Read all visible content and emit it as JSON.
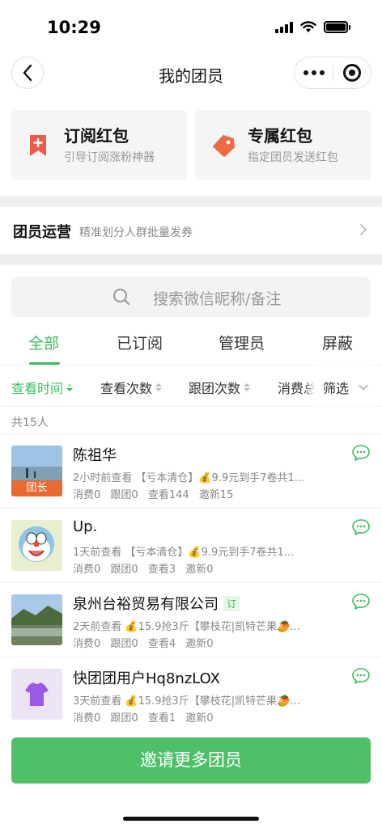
{
  "status": {
    "time": "10:29"
  },
  "nav": {
    "title": "我的团员"
  },
  "cards": [
    {
      "title": "订阅红包",
      "subtitle": "引导订阅涨粉神器",
      "icon": "bookmark-plus-icon",
      "color": "#ee5a47"
    },
    {
      "title": "专属红包",
      "subtitle": "指定团员发送红包",
      "icon": "tag-icon",
      "color": "#ee6a45"
    }
  ],
  "ops": {
    "title": "团员运营",
    "subtitle": "精准划分人群批量发券"
  },
  "search": {
    "placeholder": "搜索微信昵称/备注"
  },
  "tabs": [
    {
      "label": "全部",
      "active": true
    },
    {
      "label": "已订阅"
    },
    {
      "label": "管理员"
    },
    {
      "label": "屏蔽"
    }
  ],
  "sort": [
    {
      "label": "查看时间",
      "active": true
    },
    {
      "label": "查看次数"
    },
    {
      "label": "跟团次数"
    },
    {
      "label": "消费总"
    }
  ],
  "filter": {
    "label": "筛选"
  },
  "count": "共15人",
  "members": [
    {
      "name": "陈祖华",
      "tag": "团长",
      "line1": "2小时前查看 【亏本清仓】💰9.9元到手7卷共1...",
      "consume": "消费0",
      "join": "跟团0",
      "view": "查看144",
      "invite": "邀新15"
    },
    {
      "name": "Up.",
      "line1": "1天前查看 【亏本清仓】💰9.9元到手7卷共1...",
      "consume": "消费0",
      "join": "跟团0",
      "view": "查看3",
      "invite": "邀新0"
    },
    {
      "name": "泉州台裕贸易有限公司",
      "badge": "订",
      "line1": "2天前查看 💰15.9抢3斤【攀枝花|凯特芒果🥭...",
      "consume": "消费0",
      "join": "跟团0",
      "view": "查看4",
      "invite": "邀新0"
    },
    {
      "name": "快团团用户Hq8nzLOX",
      "line1": "3天前查看 💰15.9抢3斤【攀枝花|凯特芒果🥭...",
      "consume": "消费0",
      "join": "跟团0",
      "view": "查看1",
      "invite": "邀新0"
    }
  ],
  "invite": {
    "label": "邀请更多团员"
  },
  "colors": {
    "accent": "#3dbb5f",
    "button": "#4fbf6a",
    "leader_tag": "#ea6a34"
  }
}
